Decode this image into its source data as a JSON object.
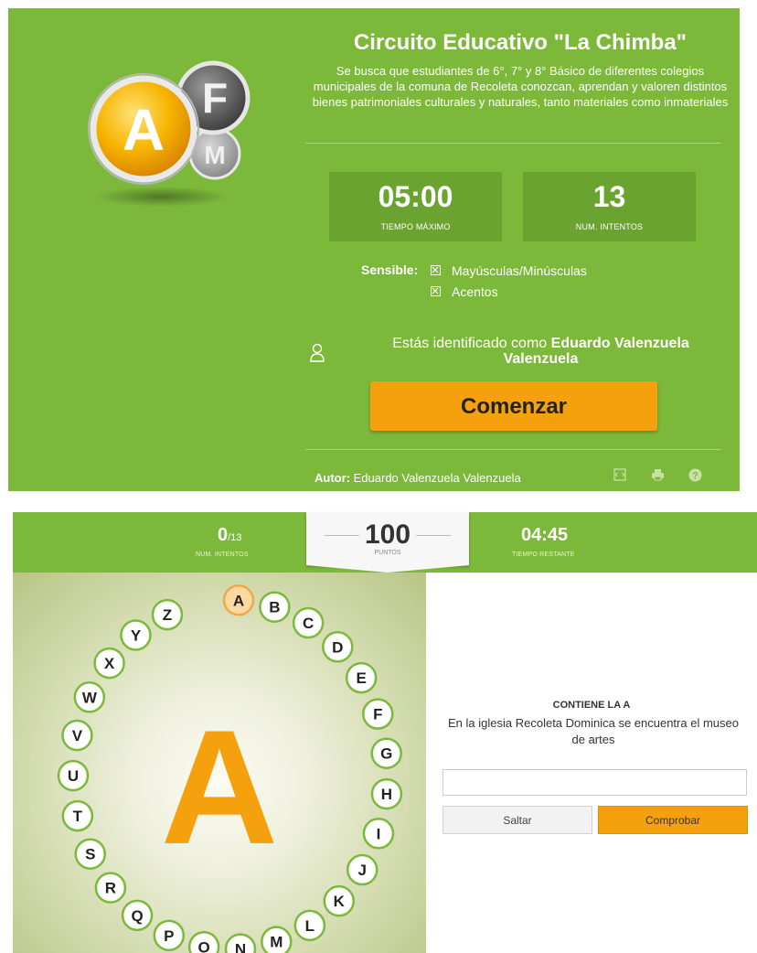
{
  "intro": {
    "title": "Circuito Educativo \"La Chimba\"",
    "description": "Se busca que estudiantes de 6°, 7° y 8° Básico de diferentes colegios municipales de la comuna de Recoleta conozcan, aprendan y valoren distintos bienes patrimoniales culturales y naturales, tanto materiales como inmateriales",
    "logo_letters": [
      "A",
      "F",
      "M"
    ],
    "max_time": {
      "value": "05:00",
      "label": "TIEMPO MÁXIMO"
    },
    "attempts": {
      "value": "13",
      "label": "NUM. INTENTOS"
    },
    "sensitive_label": "Sensible:",
    "options": [
      "Mayúsculas/Minúsculas",
      "Acentos"
    ],
    "identified_prefix": "Estás identificado como",
    "user_name": "Eduardo Valenzuela Valenzuela",
    "start_label": "Comenzar",
    "author_label": "Autor:",
    "author_name": "Eduardo Valenzuela Valenzuela",
    "footer_icons": [
      "embed-icon",
      "print-icon",
      "help-icon"
    ]
  },
  "game": {
    "attempts_used": "0",
    "attempts_total": "/13",
    "attempts_label": "NUM. INTENTOS",
    "points": "100",
    "points_label": "PUNTOS",
    "time_left": "04:45",
    "time_label": "TIEMPO RESTANTE",
    "current_letter": "A",
    "letters": [
      "A",
      "B",
      "C",
      "D",
      "E",
      "F",
      "G",
      "H",
      "I",
      "J",
      "K",
      "L",
      "M",
      "N",
      "O",
      "P",
      "Q",
      "R",
      "S",
      "T",
      "U",
      "V",
      "W",
      "X",
      "Y",
      "Z"
    ],
    "question_header": "CONTIENE LA A",
    "question_text": "En la iglesia Recoleta Dominica se encuentra el museo de artes",
    "answer_value": "",
    "skip_label": "Saltar",
    "check_label": "Comprobar"
  },
  "colors": {
    "green": "#7cb83a",
    "green_dark": "#6aa32f",
    "orange": "#f5a10e",
    "active_letter_bg": "#fcd9a0",
    "letter_border": "#7cb83a"
  }
}
